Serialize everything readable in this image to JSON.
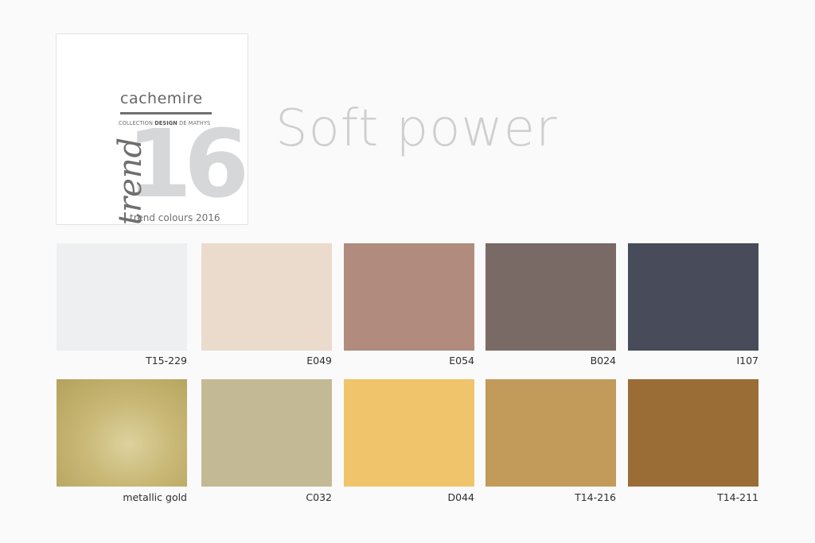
{
  "brand": {
    "name": "cachemire",
    "subtitle_prefix": "COLLECTION",
    "subtitle_emphasis": "DESIGN",
    "subtitle_suffix": "DE MATHYS",
    "big_number": "16",
    "script_word": "trend",
    "tagline": "trend colours 2016"
  },
  "title": "Soft power",
  "swatches": [
    {
      "code": "T15-229",
      "color": "#eeeff1"
    },
    {
      "code": "E049",
      "color": "#eadbcd"
    },
    {
      "code": "E054",
      "color": "#b08b7e"
    },
    {
      "code": "B024",
      "color": "#7a6a66"
    },
    {
      "code": "I107",
      "color": "#474b5a"
    },
    {
      "code": "metallic gold",
      "color": "#c7b675"
    },
    {
      "code": "C032",
      "color": "#c3b994"
    },
    {
      "code": "D044",
      "color": "#f0c46b"
    },
    {
      "code": "T14-216",
      "color": "#c29a5a"
    },
    {
      "code": "T14-211",
      "color": "#9a6c36"
    }
  ]
}
